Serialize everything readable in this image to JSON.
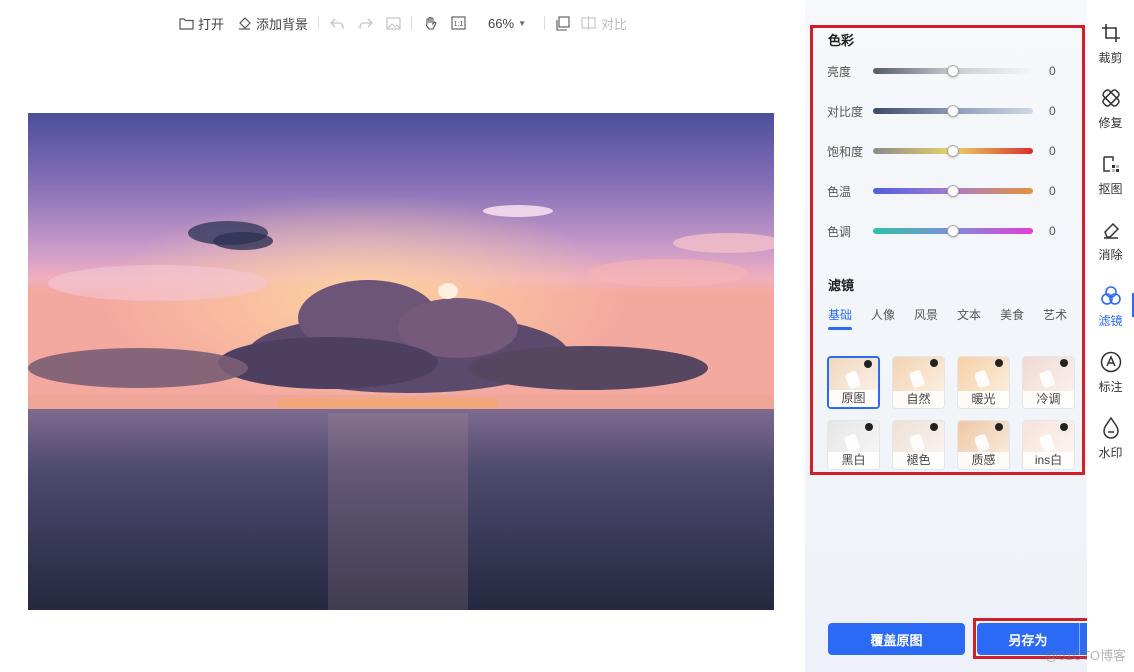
{
  "toolbar": {
    "open_label": "打开",
    "add_bg_label": "添加背景",
    "zoom_value": "66%",
    "compare_label": "对比"
  },
  "color": {
    "title": "色彩",
    "sliders": [
      {
        "label": "亮度",
        "value": "0",
        "level": 0.5,
        "gradient": "linear-gradient(90deg,#555b66,#c9ccd1,#f4f5f7)"
      },
      {
        "label": "对比度",
        "value": "0",
        "level": 0.5,
        "gradient": "linear-gradient(90deg,#3d4a66,#8a9bb8,#cfd8e6)"
      },
      {
        "label": "饱和度",
        "value": "0",
        "level": 0.5,
        "gradient": "linear-gradient(90deg,#8a8a8a,#e7d468,#d9302a)"
      },
      {
        "label": "色温",
        "value": "0",
        "level": 0.5,
        "gradient": "linear-gradient(90deg,#4e5fe0,#a97dc9,#e3923a)"
      },
      {
        "label": "色调",
        "value": "0",
        "level": 0.5,
        "gradient": "linear-gradient(90deg,#2ec1a7,#7f8fd8,#e23dd6)"
      }
    ]
  },
  "filter": {
    "title": "滤镜",
    "tabs": [
      "基础",
      "人像",
      "风景",
      "文本",
      "美食",
      "艺术"
    ],
    "active_tab": "基础",
    "items": [
      {
        "label": "原图",
        "color": "#f0d8bf",
        "selected": true
      },
      {
        "label": "自然",
        "color": "#f3d3b3",
        "selected": false
      },
      {
        "label": "暖光",
        "color": "#f6d0a6",
        "selected": false
      },
      {
        "label": "冷调",
        "color": "#f1d9d2",
        "selected": false
      },
      {
        "label": "黑白",
        "color": "#e6e6e6",
        "selected": false
      },
      {
        "label": "褪色",
        "color": "#efe0d4",
        "selected": false
      },
      {
        "label": "质感",
        "color": "#efc7a4",
        "selected": false
      },
      {
        "label": "ins白",
        "color": "#f7e3da",
        "selected": false
      }
    ]
  },
  "actions": {
    "cover_label": "覆盖原图",
    "save_as_label": "另存为"
  },
  "tools": [
    {
      "label": "裁剪",
      "icon": "crop-icon"
    },
    {
      "label": "修复",
      "icon": "repair-icon"
    },
    {
      "label": "抠图",
      "icon": "cutout-icon"
    },
    {
      "label": "消除",
      "icon": "eraser-icon"
    },
    {
      "label": "滤镜",
      "icon": "filter-icon",
      "active": true
    },
    {
      "label": "标注",
      "icon": "annotate-icon"
    },
    {
      "label": "水印",
      "icon": "watermark-icon"
    }
  ],
  "accent": "#2a6af5",
  "highlight": "#d0212a",
  "watermark_text": "@51CTO博客"
}
